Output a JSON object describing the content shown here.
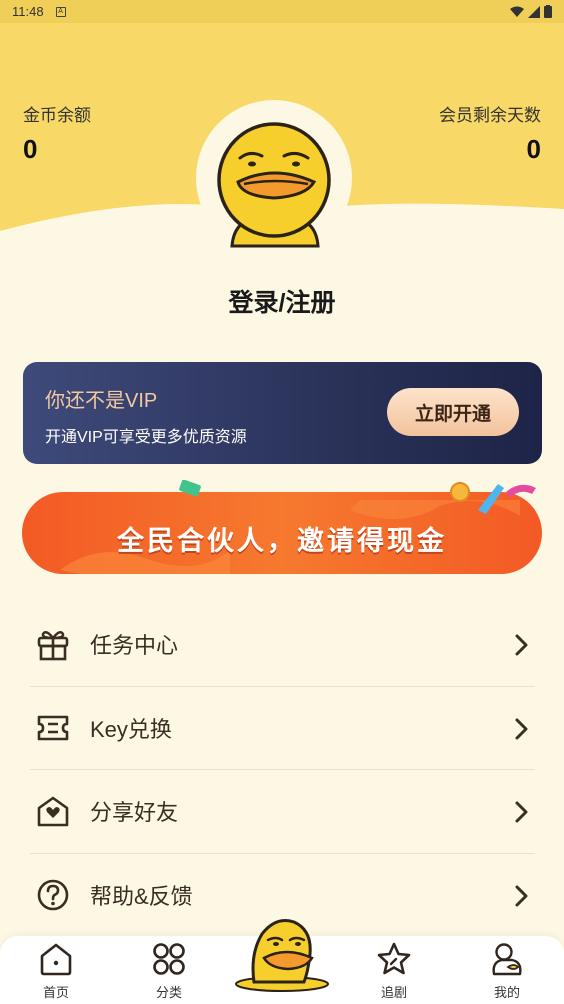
{
  "status_bar": {
    "time": "11:48",
    "notif_icon": "A"
  },
  "stats": {
    "coins": {
      "label": "金币余额",
      "value": "0"
    },
    "member_days": {
      "label": "会员剩余天数",
      "value": "0"
    }
  },
  "profile": {
    "login_label": "登录/注册"
  },
  "vip_card": {
    "title": "你还不是VIP",
    "subtitle": "开通VIP可享受更多优质资源",
    "button": "立即开通"
  },
  "banner": {
    "text": "全民合伙人，邀请得现金"
  },
  "menu": [
    {
      "label": "任务中心",
      "icon": "gift-icon"
    },
    {
      "label": "Key兑换",
      "icon": "ticket-icon"
    },
    {
      "label": "分享好友",
      "icon": "share-heart-icon"
    },
    {
      "label": "帮助&反馈",
      "icon": "help-icon"
    }
  ],
  "tabs": [
    {
      "label": "首页",
      "icon": "home-icon"
    },
    {
      "label": "分类",
      "icon": "category-icon"
    },
    {
      "label": "",
      "icon": "duck-icon"
    },
    {
      "label": "追剧",
      "icon": "star-icon"
    },
    {
      "label": "我的",
      "icon": "duck-outline-icon"
    }
  ],
  "colors": {
    "header_yellow": "#f8d866",
    "page_bg": "#fdf8e4",
    "vip_dark": "#2a3259",
    "vip_gold": "#f3c9a2",
    "banner_orange": "#f06a2a"
  }
}
